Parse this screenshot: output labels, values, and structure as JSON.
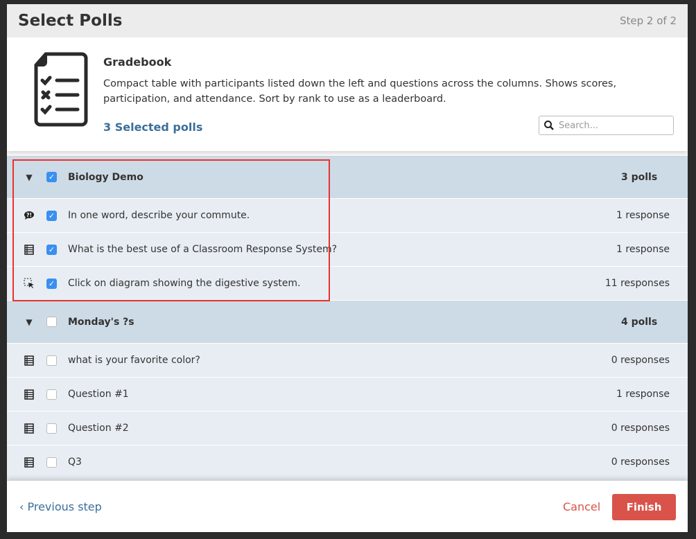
{
  "header": {
    "title": "Select Polls",
    "step": "Step 2 of 2"
  },
  "intro": {
    "icon": "gradebook-document-icon",
    "title": "Gradebook",
    "description": "Compact table with participants listed down the left and questions across the columns. Shows scores, participation, and attendance. Sort by rank to use as a leaderboard.",
    "selected": "3 Selected polls",
    "search_placeholder": "Search..."
  },
  "groups": [
    {
      "name": "Biology Demo",
      "count": "3 polls",
      "checked": true,
      "items": [
        {
          "icon": "speech-bubble-icon",
          "label": "In one word, describe your commute.",
          "count": "1 response",
          "checked": true
        },
        {
          "icon": "list-icon",
          "label": "What is the best use of a Classroom Response System?",
          "count": "1 response",
          "checked": true
        },
        {
          "icon": "click-region-icon",
          "label": "Click on diagram showing the digestive system.",
          "count": "11 responses",
          "checked": true
        }
      ]
    },
    {
      "name": "Monday's ?s",
      "count": "4 polls",
      "checked": false,
      "items": [
        {
          "icon": "list-icon",
          "label": "what is your favorite color?",
          "count": "0 responses",
          "checked": false
        },
        {
          "icon": "list-icon",
          "label": "Question #1",
          "count": "1 response",
          "checked": false
        },
        {
          "icon": "list-icon",
          "label": "Question #2",
          "count": "0 responses",
          "checked": false
        },
        {
          "icon": "list-icon",
          "label": "Q3",
          "count": "0 responses",
          "checked": false
        }
      ]
    }
  ],
  "footer": {
    "previous": "Previous step",
    "cancel": "Cancel",
    "finish": "Finish"
  },
  "colors": {
    "accent": "#3b8ff0",
    "link": "#3a6f9c",
    "danger": "#d9534a",
    "highlight": "#e8322b"
  }
}
